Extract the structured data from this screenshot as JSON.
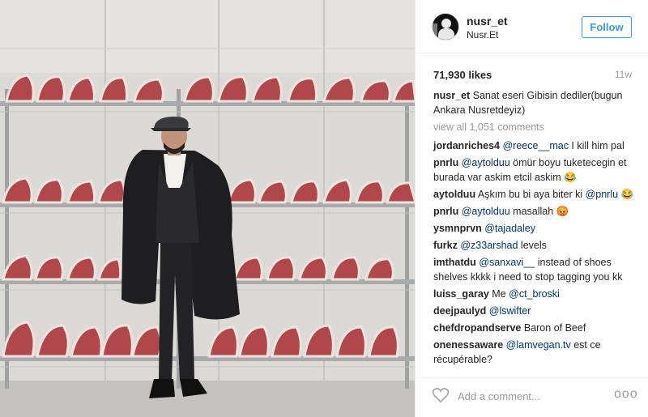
{
  "header": {
    "username": "nusr_et",
    "location": "Nusr.Et",
    "follow_label": "Follow"
  },
  "stats": {
    "likes": "71,930 likes",
    "age": "11w"
  },
  "caption": {
    "user": "nusr_et",
    "text": "Sanat eseri Gibisin dediler(bugun Ankara Nusretdeyiz)"
  },
  "view_all": "view all 1,051 comments",
  "comments": [
    {
      "user": "jordanriches4",
      "mention": "@reece__mac",
      "text": " I kill him pal"
    },
    {
      "user": "pnrlu",
      "mention": "@aytolduu",
      "text": " ömür boyu tuketecegin et burada var askim etcil askim 😂"
    },
    {
      "user": "aytolduu",
      "pre": "Aşkım bu bi aya biter ki ",
      "mention": "@pnrlu",
      "text": " 😂"
    },
    {
      "user": "pnrlu",
      "mention": "@aytolduu",
      "text": " masallah 😡"
    },
    {
      "user": "ysmnprvn",
      "mention": "@tajadaley",
      "text": ""
    },
    {
      "user": "furkz",
      "mention": "@z33arshad",
      "text": " levels"
    },
    {
      "user": "imthatdu",
      "mention": "@sanxavi__",
      "text": " instead of shoes shelves kkkk i need to stop tagging you kk"
    },
    {
      "user": "luiss_garay",
      "pre": "Me ",
      "mention": "@ct_broski",
      "text": ""
    },
    {
      "user": "deejpaulyd",
      "mention": "@lswifter",
      "text": ""
    },
    {
      "user": "chefdropandserve",
      "pre": "Baron of Beef",
      "mention": "",
      "text": ""
    },
    {
      "user": "onenessaware",
      "mention": "@lamvegan.tv",
      "text": " est ce récupérable?"
    }
  ],
  "footer": {
    "comment_placeholder": "Add a comment...",
    "more_label": "ooo"
  },
  "icons": {
    "heart": "heart-outline-icon",
    "more": "ellipsis-icon"
  },
  "colors": {
    "follow_blue": "#3897f0",
    "mention_blue": "#003569",
    "muted": "#999999"
  }
}
